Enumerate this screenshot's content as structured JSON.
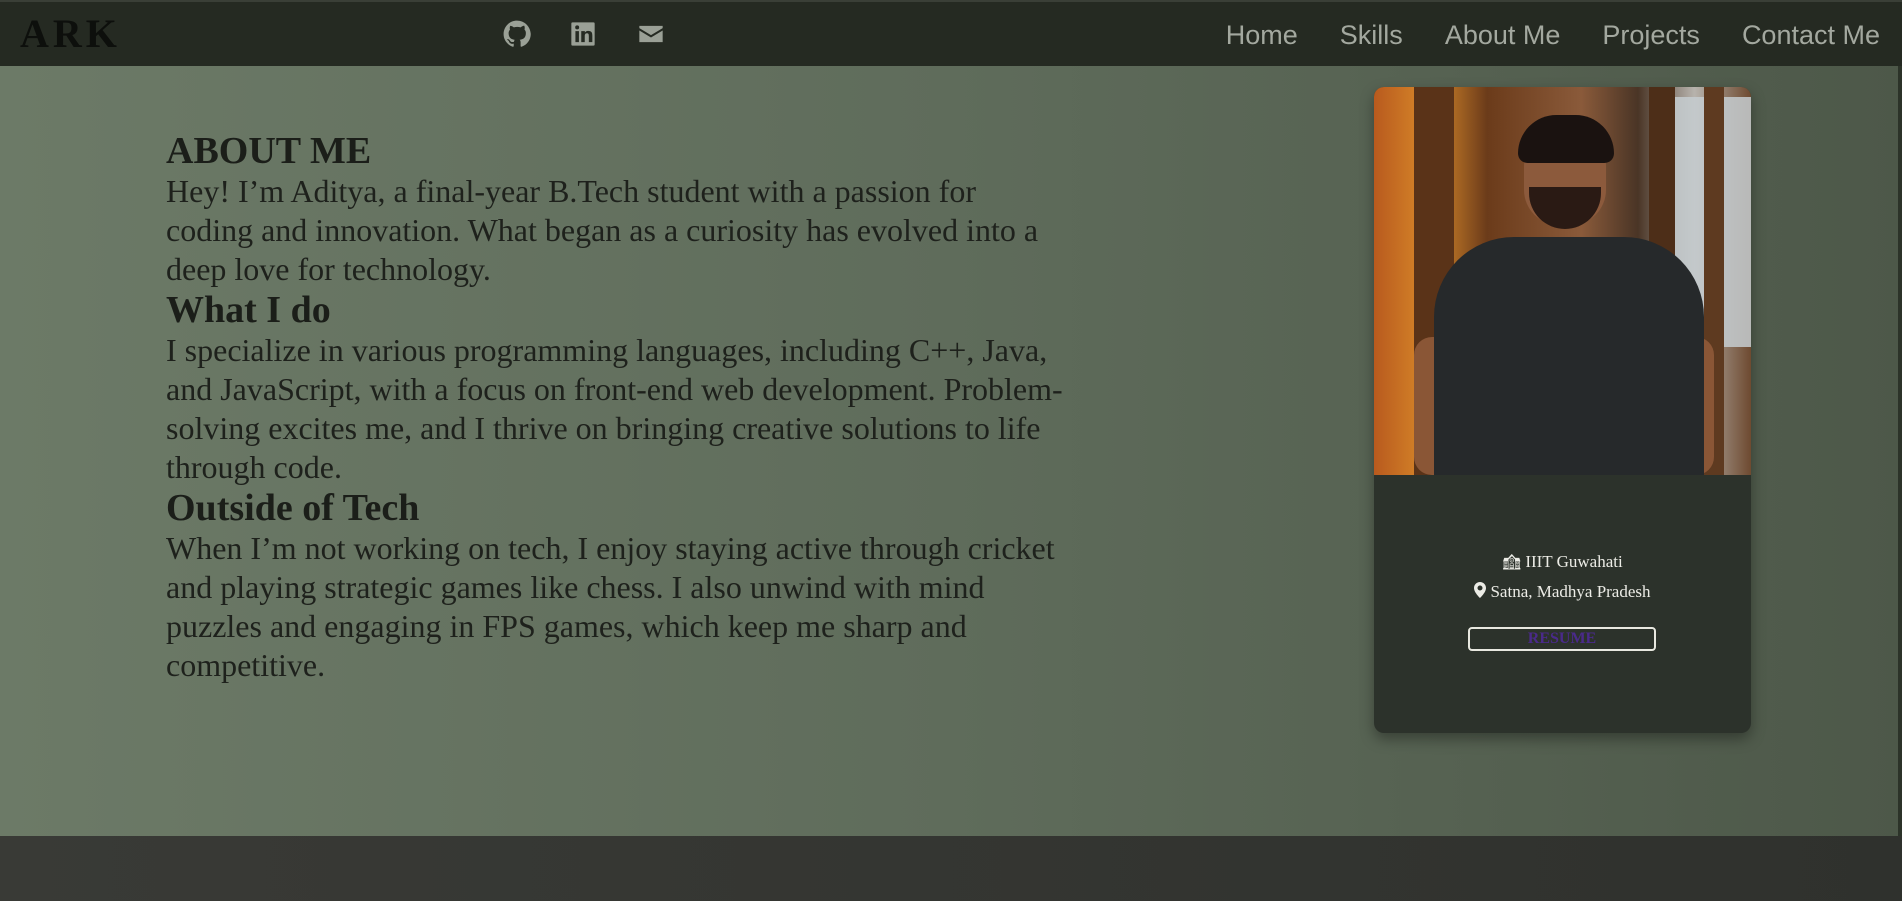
{
  "header": {
    "logo": "ARK",
    "social": [
      {
        "icon": "github-icon"
      },
      {
        "icon": "linkedin-icon"
      },
      {
        "icon": "mail-icon"
      }
    ],
    "nav": [
      "Home",
      "Skills",
      "About Me",
      "Projects",
      "Contact Me"
    ]
  },
  "about": {
    "title": "ABOUT ME",
    "intro": "Hey! I’m Aditya, a final-year B.Tech student with a passion for coding and innovation. What began as a curiosity has evolved into a deep love for technology.",
    "what_title": "What I do",
    "what_text": "I specialize in various programming languages, including C++, Java, and JavaScript, with a focus on front-end web development. Problem-solving excites me, and I thrive on bringing creative solutions to life through code.",
    "outside_title": "Outside of Tech",
    "outside_text": "When I’m not working on tech, I enjoy staying active through cricket and playing strategic games like chess. I also unwind with mind puzzles and engaging in FPS games, which keep me sharp and competitive."
  },
  "card": {
    "college_icon": "school-icon",
    "college": "IIIT Guwahati",
    "location_icon": "map-pin-icon",
    "location": "Satna, Madhya Pradesh",
    "resume_label": "RESUME"
  },
  "colors": {
    "navbar": "#252a22",
    "card": "#2c322b",
    "nav_text": "#a3a89f",
    "resume_text": "#4a2a8a"
  }
}
